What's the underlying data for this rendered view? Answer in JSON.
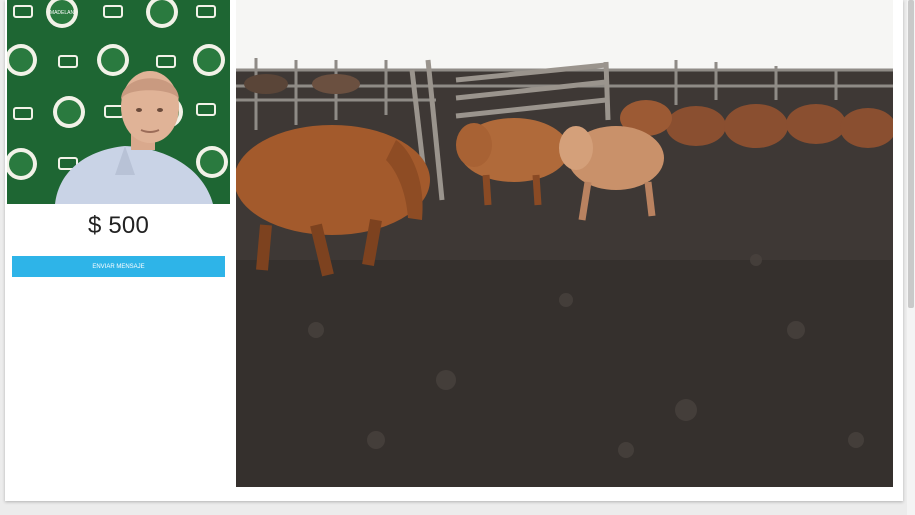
{
  "auction": {
    "current_bid": "$ 500",
    "send_button_label": "ENVIAR MENSAJE"
  },
  "presenter_backdrop": {
    "logo_text": "MADELAN"
  },
  "colors": {
    "button": "#2eb4e8",
    "backdrop": "#1f6a35",
    "ground": "#3a3532",
    "cattle": "#a35a2c"
  }
}
